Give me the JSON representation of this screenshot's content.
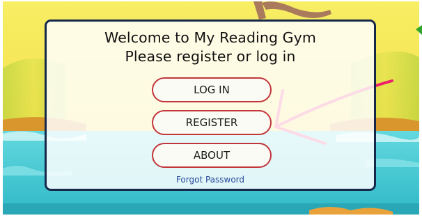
{
  "welcome": {
    "line1": "Welcome to My Reading Gym",
    "line2": "Please register or log in"
  },
  "buttons": {
    "login": "LOG IN",
    "register": "REGISTER",
    "about": "ABOUT"
  },
  "links": {
    "forgot_password": "Forgot Password"
  },
  "colors": {
    "panel_border": "#15284a",
    "button_border": "#c2363a",
    "link": "#2a4a9a",
    "annotation_arrow": "#ec1f6a",
    "sky": "#f6e44a",
    "water": "#36c7d4",
    "sand": "#e7b23c"
  },
  "icons": {
    "annotation": "arrow-annotation-icon",
    "right_edge": "green-arrow-icon"
  }
}
